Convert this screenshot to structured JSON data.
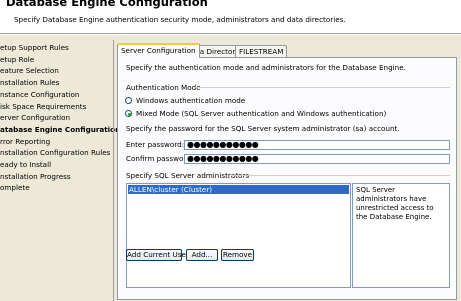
{
  "header": {
    "title": "Database Engine Configuration",
    "subtitle": "Specify Database Engine authentication security mode, administrators and data directories."
  },
  "nav": {
    "items": [
      {
        "label": "etup Support Rules",
        "active": false
      },
      {
        "label": "etup Role",
        "active": false
      },
      {
        "label": "eature Selection",
        "active": false
      },
      {
        "label": "nstallation Rules",
        "active": false
      },
      {
        "label": "nstance Configuration",
        "active": false
      },
      {
        "label": "isk Space Requirements",
        "active": false
      },
      {
        "label": "erver Configuration",
        "active": false
      },
      {
        "label": "atabase Engine Configuration",
        "active": true
      },
      {
        "label": "rror Reporting",
        "active": false
      },
      {
        "label": "nstallation Configuration Rules",
        "active": false
      },
      {
        "label": "eady to Install",
        "active": false
      },
      {
        "label": "nstallation Progress",
        "active": false
      },
      {
        "label": "omplete",
        "active": false
      }
    ]
  },
  "tabs": [
    {
      "label": "Server Configuration",
      "active": true
    },
    {
      "label": "Data Directories",
      "active": false
    },
    {
      "label": "FILESTREAM",
      "active": false
    }
  ],
  "panel": {
    "intro": "Specify the authentication mode and administrators for the Database Engine.",
    "auth_mode_heading": "Authentication Mode",
    "windows_auth_label": "Windows authentication mode",
    "mixed_mode_label": "Mixed Mode (SQL Server authentication and Windows authentication)",
    "selected_mode": "mixed",
    "password_heading": "Specify the password for the SQL Server system administrator (sa) account.",
    "enter_password_label": "Enter password:",
    "enter_password_value": "●●●●●●●●●●●",
    "confirm_password_label": "Confirm password:",
    "confirm_password_value": "●●●●●●●●●●●",
    "admins_heading": "Specify SQL Server administrators",
    "admins": [
      "ALLEN\\cluster (Cluster)"
    ],
    "admins_info": "SQL Server administrators have unrestricted access to the Database Engine.",
    "buttons": {
      "add_current_user": "Add Current User",
      "add": "Add...",
      "remove": "Remove"
    }
  },
  "colors": {
    "selection": "#316ac5",
    "tab_highlight": "#ffc83c",
    "radio_dot": "#21a121",
    "dialog_bg": "#ece9d8"
  }
}
